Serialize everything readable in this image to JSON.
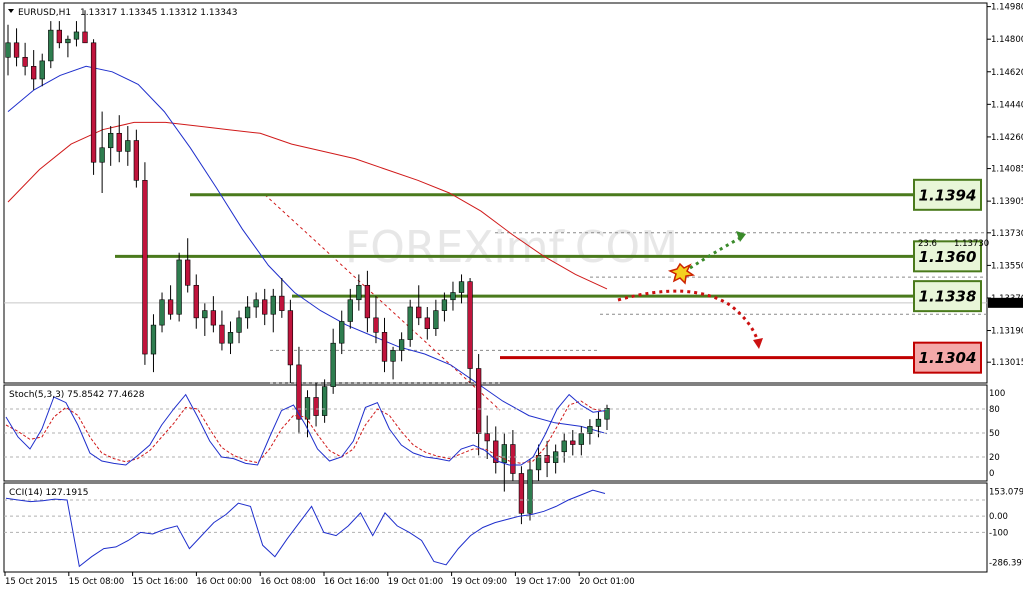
{
  "chart_data": {
    "type": "candlestick",
    "symbol_title": "EURUSD,H1",
    "ohlc_header": "1.13317 1.13345 1.13312 1.13343",
    "price_range": [
      1.129,
      1.15
    ],
    "price_ticks": [
      "1.14980",
      "1.14800",
      "1.14620",
      "1.14440",
      "1.14260",
      "1.14085",
      "1.13905",
      "1.13730",
      "1.13550",
      "1.13370",
      "1.13190",
      "1.13015"
    ],
    "current_price": "1.13343",
    "fib_label": "23.6",
    "fib_price": "1.13730",
    "candle_colors": {
      "bull": "#2e7d4f",
      "bear": "#c0143c"
    },
    "candles": [
      [
        1.147,
        1.1488,
        1.146,
        1.1478
      ],
      [
        1.1478,
        1.1486,
        1.1465,
        1.147
      ],
      [
        1.147,
        1.1478,
        1.146,
        1.1465
      ],
      [
        1.1465,
        1.1474,
        1.1452,
        1.1458
      ],
      [
        1.1458,
        1.1472,
        1.1454,
        1.1468
      ],
      [
        1.1468,
        1.149,
        1.1464,
        1.1485
      ],
      [
        1.1485,
        1.149,
        1.1475,
        1.1478
      ],
      [
        1.1478,
        1.1482,
        1.147,
        1.148
      ],
      [
        1.148,
        1.149,
        1.1476,
        1.1484
      ],
      [
        1.1484,
        1.1496,
        1.1482,
        1.1478
      ],
      [
        1.1478,
        1.148,
        1.1405,
        1.1412
      ],
      [
        1.1412,
        1.144,
        1.1395,
        1.142
      ],
      [
        1.142,
        1.1432,
        1.141,
        1.1428
      ],
      [
        1.1428,
        1.1438,
        1.1412,
        1.1418
      ],
      [
        1.1418,
        1.1432,
        1.141,
        1.1424
      ],
      [
        1.1424,
        1.143,
        1.1398,
        1.1402
      ],
      [
        1.1402,
        1.1412,
        1.13,
        1.1306
      ],
      [
        1.1306,
        1.1328,
        1.1296,
        1.1322
      ],
      [
        1.1322,
        1.134,
        1.1318,
        1.1336
      ],
      [
        1.1336,
        1.1344,
        1.1325,
        1.1328
      ],
      [
        1.1328,
        1.1362,
        1.1324,
        1.1358
      ],
      [
        1.1358,
        1.137,
        1.134,
        1.1344
      ],
      [
        1.1344,
        1.135,
        1.132,
        1.1326
      ],
      [
        1.1326,
        1.1334,
        1.1316,
        1.133
      ],
      [
        1.133,
        1.1338,
        1.1318,
        1.1322
      ],
      [
        1.1322,
        1.133,
        1.1308,
        1.1312
      ],
      [
        1.1312,
        1.1324,
        1.1306,
        1.1318
      ],
      [
        1.1318,
        1.133,
        1.1312,
        1.1326
      ],
      [
        1.1326,
        1.1338,
        1.132,
        1.1332
      ],
      [
        1.1332,
        1.134,
        1.1326,
        1.1336
      ],
      [
        1.1336,
        1.1342,
        1.1322,
        1.1328
      ],
      [
        1.1328,
        1.1342,
        1.1318,
        1.1338
      ],
      [
        1.1338,
        1.1348,
        1.1326,
        1.133
      ],
      [
        1.133,
        1.1336,
        1.129,
        1.13
      ],
      [
        1.13,
        1.131,
        1.1262,
        1.127
      ],
      [
        1.127,
        1.1286,
        1.126,
        1.1282
      ],
      [
        1.1282,
        1.129,
        1.1266,
        1.1272
      ],
      [
        1.1272,
        1.1292,
        1.1268,
        1.1288
      ],
      [
        1.1288,
        1.132,
        1.1284,
        1.1312
      ],
      [
        1.1312,
        1.133,
        1.1306,
        1.1324
      ],
      [
        1.1324,
        1.1342,
        1.132,
        1.1336
      ],
      [
        1.1336,
        1.135,
        1.133,
        1.1344
      ],
      [
        1.1344,
        1.1352,
        1.1318,
        1.1326
      ],
      [
        1.1326,
        1.1338,
        1.1312,
        1.1318
      ],
      [
        1.1318,
        1.1326,
        1.1296,
        1.1302
      ],
      [
        1.1302,
        1.131,
        1.1292,
        1.1308
      ],
      [
        1.1308,
        1.1318,
        1.1302,
        1.1314
      ],
      [
        1.1314,
        1.1336,
        1.131,
        1.1332
      ],
      [
        1.1332,
        1.1344,
        1.1322,
        1.1326
      ],
      [
        1.1326,
        1.1332,
        1.1314,
        1.132
      ],
      [
        1.132,
        1.1336,
        1.1316,
        1.133
      ],
      [
        1.133,
        1.134,
        1.1324,
        1.1336
      ],
      [
        1.1336,
        1.1346,
        1.133,
        1.134
      ],
      [
        1.134,
        1.135,
        1.1334,
        1.1346
      ],
      [
        1.1346,
        1.1348,
        1.129,
        1.1298
      ],
      [
        1.1298,
        1.1306,
        1.125,
        1.1262
      ],
      [
        1.1262,
        1.1272,
        1.1248,
        1.1258
      ],
      [
        1.1258,
        1.1266,
        1.124,
        1.1246
      ],
      [
        1.1246,
        1.1262,
        1.123,
        1.1256
      ],
      [
        1.1256,
        1.1264,
        1.1236,
        1.124
      ],
      [
        1.124,
        1.1244,
        1.1212,
        1.1218
      ],
      [
        1.1218,
        1.1248,
        1.1214,
        1.1242
      ],
      [
        1.1242,
        1.1256,
        1.1236,
        1.125
      ],
      [
        1.125,
        1.1258,
        1.1238,
        1.1246
      ],
      [
        1.1246,
        1.1256,
        1.124,
        1.1252
      ],
      [
        1.1252,
        1.1262,
        1.1246,
        1.1258
      ],
      [
        1.1258,
        1.1264,
        1.125,
        1.1256
      ],
      [
        1.1256,
        1.1266,
        1.125,
        1.1262
      ],
      [
        1.1262,
        1.127,
        1.1256,
        1.1266
      ],
      [
        1.1266,
        1.1274,
        1.126,
        1.127
      ],
      [
        1.127,
        1.1278,
        1.1264,
        1.1276
      ]
    ],
    "ma_blue": {
      "color": "#1f2fcc",
      "values": [
        1.144,
        1.1452,
        1.146,
        1.1465,
        1.1462,
        1.1455,
        1.144,
        1.142,
        1.1398,
        1.1375,
        1.1355,
        1.134,
        1.133,
        1.1322,
        1.1316,
        1.131,
        1.1306,
        1.13,
        1.129,
        1.128,
        1.1272,
        1.1268,
        1.1266,
        1.1262
      ]
    },
    "ma_red": {
      "color": "#d01a1a",
      "values": [
        1.139,
        1.1408,
        1.1422,
        1.143,
        1.1434,
        1.1434,
        1.1432,
        1.143,
        1.1428,
        1.1422,
        1.1418,
        1.1414,
        1.1408,
        1.1402,
        1.1395,
        1.1385,
        1.1372,
        1.136,
        1.135,
        1.1342
      ]
    },
    "levels": [
      {
        "label": "1.1394",
        "price": 1.1394,
        "color": "#4a7a1c",
        "fill": "#e8f6d8"
      },
      {
        "label": "1.1360",
        "price": 1.136,
        "color": "#4a7a1c",
        "fill": "#e8f6d8"
      },
      {
        "label": "1.1338",
        "price": 1.1338,
        "color": "#4a7a1c",
        "fill": "#e8f6d8"
      },
      {
        "label": "1.1304",
        "price": 1.1304,
        "color": "#c00000",
        "fill": "#f4a8a8"
      }
    ],
    "stoch": {
      "title": "Stoch(5,3,3) 75.8542 77.4628",
      "ticks": [
        "100",
        "80",
        "50",
        "20",
        "0"
      ],
      "main_color": "#1f2fcc",
      "signal_color": "#d01a1a",
      "main": [
        70,
        45,
        30,
        55,
        95,
        88,
        60,
        25,
        15,
        12,
        10,
        22,
        35,
        60,
        80,
        98,
        70,
        40,
        20,
        18,
        12,
        10,
        45,
        78,
        85,
        60,
        30,
        15,
        20,
        40,
        82,
        88,
        55,
        35,
        25,
        20,
        18,
        15,
        30,
        35,
        28,
        15,
        10,
        10,
        20,
        48,
        80,
        98,
        85,
        76,
        78
      ],
      "signal": [
        60,
        52,
        42,
        45,
        70,
        82,
        72,
        45,
        25,
        18,
        14,
        18,
        28,
        45,
        62,
        82,
        80,
        55,
        32,
        22,
        16,
        13,
        30,
        55,
        72,
        70,
        48,
        28,
        20,
        30,
        60,
        80,
        72,
        52,
        35,
        26,
        21,
        18,
        24,
        30,
        30,
        22,
        15,
        12,
        15,
        32,
        58,
        85,
        90,
        80,
        77
      ]
    },
    "cci": {
      "title": "CCI(14) 127.1915",
      "ticks": [
        "153.079",
        "0.00",
        "-100",
        "-286.397"
      ],
      "color": "#1f2fcc",
      "values": [
        110,
        100,
        90,
        95,
        105,
        100,
        -310,
        -250,
        -200,
        -190,
        -150,
        -100,
        -110,
        -80,
        -60,
        -200,
        -120,
        -40,
        10,
        80,
        60,
        -180,
        -250,
        -140,
        -40,
        60,
        -100,
        -120,
        -60,
        20,
        -120,
        20,
        -60,
        -100,
        -150,
        -280,
        -300,
        -200,
        -120,
        -70,
        -40,
        -20,
        0,
        10,
        30,
        60,
        100,
        130,
        160,
        140
      ]
    },
    "time_labels": [
      "15 Oct 2015",
      "15 Oct 08:00",
      "15 Oct 16:00",
      "16 Oct 00:00",
      "16 Oct 08:00",
      "16 Oct 16:00",
      "19 Oct 01:00",
      "19 Oct 09:00",
      "19 Oct 17:00",
      "20 Oct 01:00"
    ],
    "watermark": "FOREXimf.COM"
  }
}
